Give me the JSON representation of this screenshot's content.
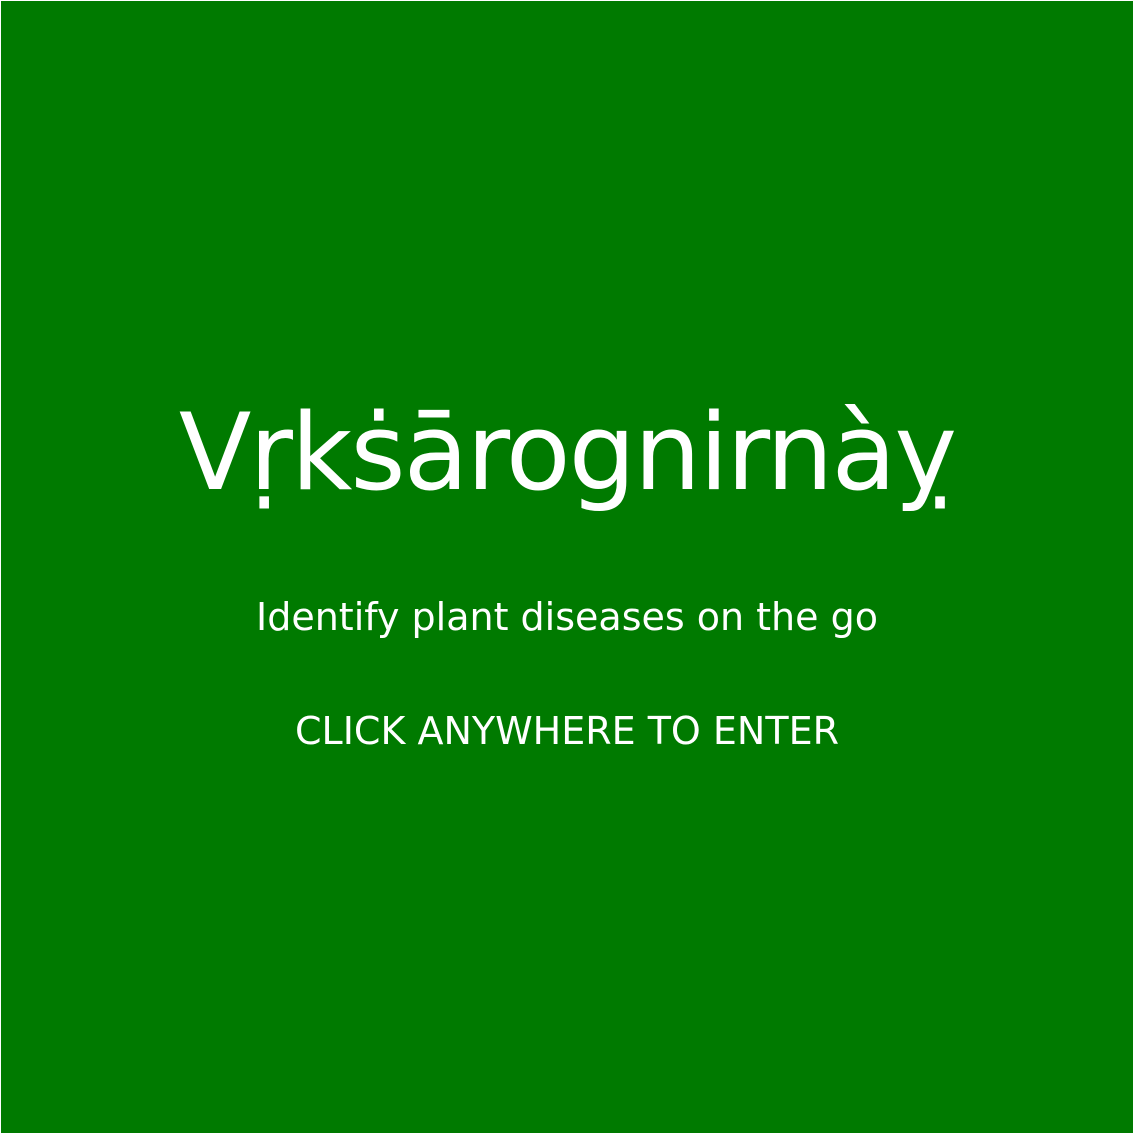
{
  "splash": {
    "title": "Vṛkṡārognirnàỵ",
    "tagline": "Identify plant diseases on the go",
    "enter_prompt": "CLICK ANYWHERE TO ENTER"
  },
  "colors": {
    "background": "#007a00",
    "text": "#ffffff"
  }
}
